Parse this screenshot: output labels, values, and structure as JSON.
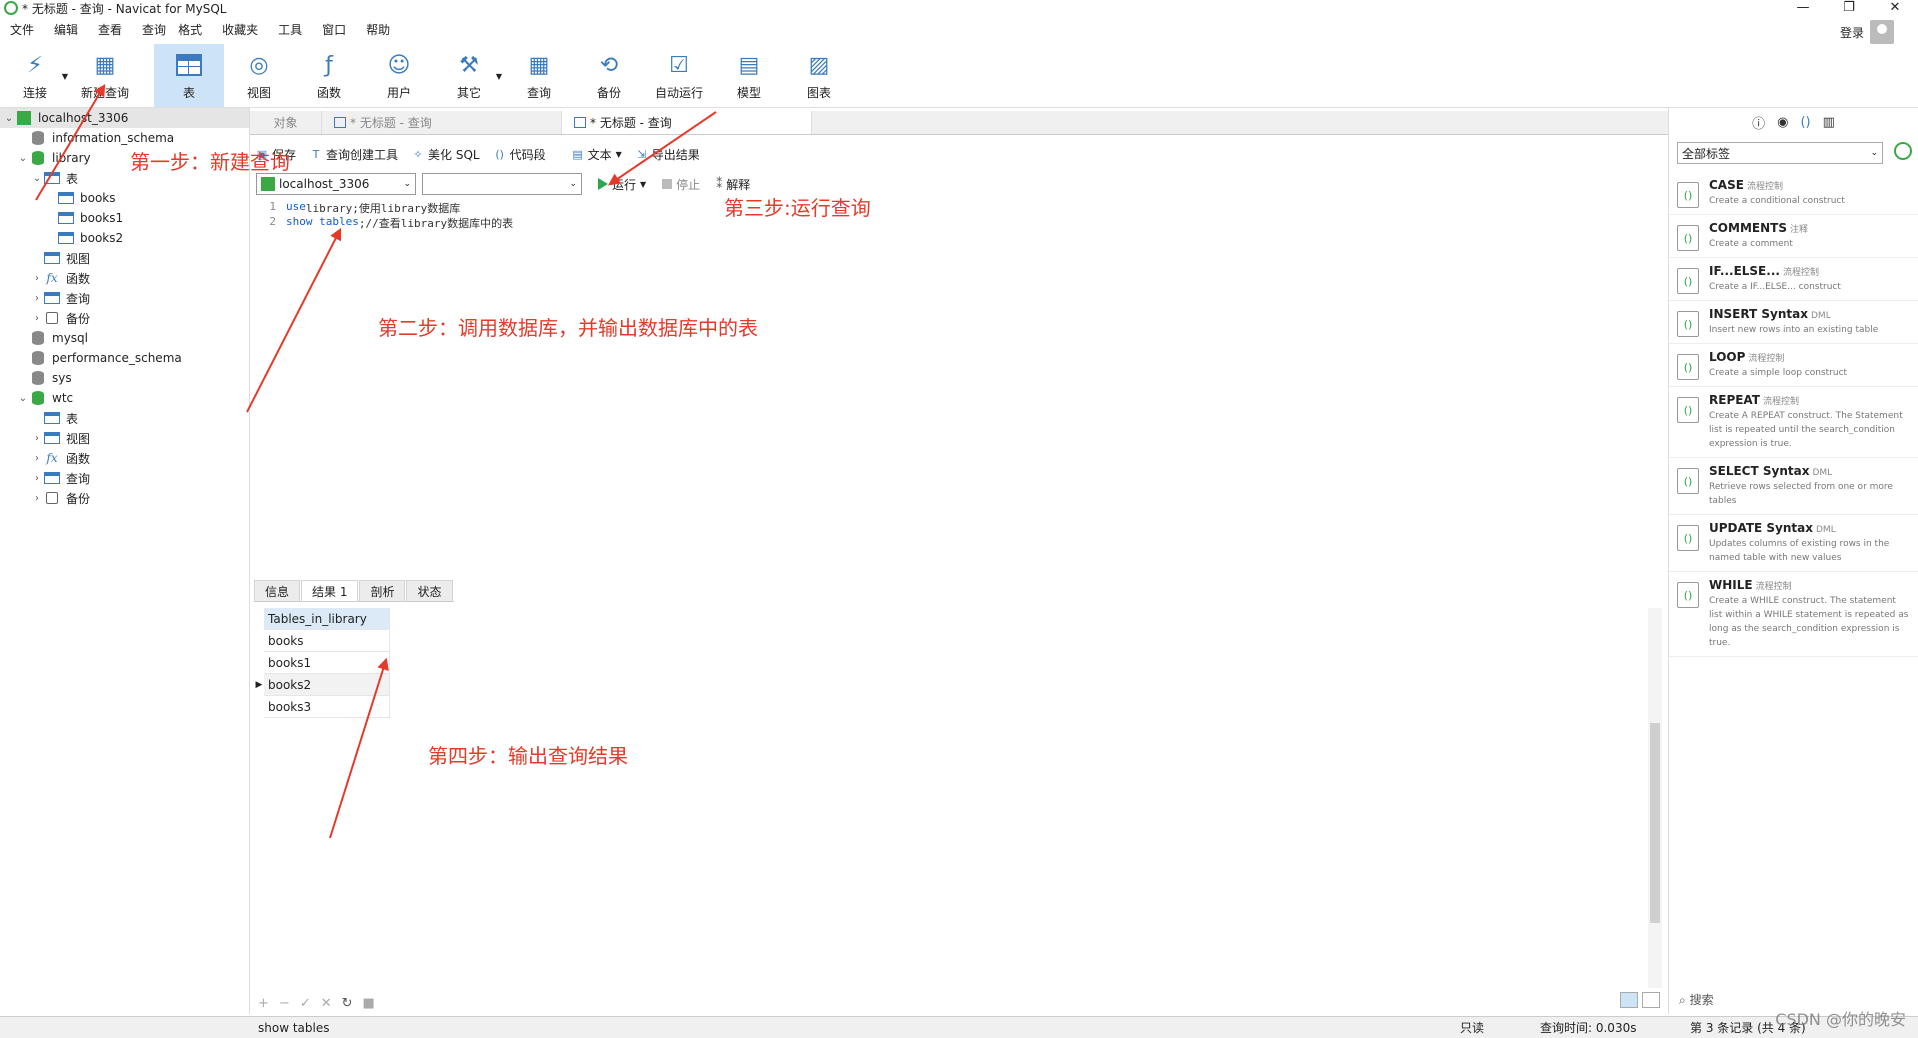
{
  "window": {
    "title": "* 无标题 - 查询 - Navicat for MySQL",
    "controls": [
      "—",
      "❐",
      "✕"
    ]
  },
  "menu": [
    "文件",
    "编辑",
    "查看",
    "查询",
    "格式",
    "收藏夹",
    "工具",
    "窗口",
    "帮助"
  ],
  "login_label": "登录",
  "toolbar": [
    {
      "label": "连接",
      "icon": "plug-icon",
      "drop": true
    },
    {
      "label": "新建查询",
      "icon": "new-query-icon"
    },
    {
      "label": "表",
      "icon": "table-icon",
      "active": true
    },
    {
      "label": "视图",
      "icon": "view-icon"
    },
    {
      "label": "函数",
      "icon": "function-icon"
    },
    {
      "label": "用户",
      "icon": "user-icon"
    },
    {
      "label": "其它",
      "icon": "tools-icon",
      "drop": true
    },
    {
      "label": "查询",
      "icon": "query-icon"
    },
    {
      "label": "备份",
      "icon": "backup-icon"
    },
    {
      "label": "自动运行",
      "icon": "automation-icon"
    },
    {
      "label": "模型",
      "icon": "model-icon"
    },
    {
      "label": "图表",
      "icon": "chart-icon"
    }
  ],
  "tree": [
    {
      "label": "localhost_3306",
      "level": 0,
      "chev": "⌄",
      "icon": "conn",
      "selected": true
    },
    {
      "label": "information_schema",
      "level": 1,
      "chev": "",
      "icon": "db"
    },
    {
      "label": "library",
      "level": 1,
      "chev": "⌄",
      "icon": "dbgreen"
    },
    {
      "label": "表",
      "level": 2,
      "chev": "⌄",
      "icon": "table"
    },
    {
      "label": "books",
      "level": 3,
      "chev": "",
      "icon": "table"
    },
    {
      "label": "books1",
      "level": 3,
      "chev": "",
      "icon": "table"
    },
    {
      "label": "books2",
      "level": 3,
      "chev": "",
      "icon": "table"
    },
    {
      "label": "视图",
      "level": 2,
      "chev": "",
      "icon": "table"
    },
    {
      "label": "函数",
      "level": 2,
      "chev": "›",
      "icon": "fx"
    },
    {
      "label": "查询",
      "level": 2,
      "chev": "›",
      "icon": "table"
    },
    {
      "label": "备份",
      "level": 2,
      "chev": "›",
      "icon": "backup"
    },
    {
      "label": "mysql",
      "level": 1,
      "chev": "",
      "icon": "db"
    },
    {
      "label": "performance_schema",
      "level": 1,
      "chev": "",
      "icon": "db"
    },
    {
      "label": "sys",
      "level": 1,
      "chev": "",
      "icon": "db"
    },
    {
      "label": "wtc",
      "level": 1,
      "chev": "⌄",
      "icon": "dbgreen"
    },
    {
      "label": "表",
      "level": 2,
      "chev": "",
      "icon": "table"
    },
    {
      "label": "视图",
      "level": 2,
      "chev": "›",
      "icon": "table"
    },
    {
      "label": "函数",
      "level": 2,
      "chev": "›",
      "icon": "fx"
    },
    {
      "label": "查询",
      "level": 2,
      "chev": "›",
      "icon": "table"
    },
    {
      "label": "备份",
      "level": 2,
      "chev": "›",
      "icon": "backup"
    }
  ],
  "doc_tabs": [
    {
      "label": "对象",
      "active": false
    },
    {
      "label": "* 无标题 - 查询",
      "active": false
    },
    {
      "label": "* 无标题 - 查询",
      "active": true
    }
  ],
  "query_toolbar": {
    "save": "保存",
    "builder": "查询创建工具",
    "beautify": "美化 SQL",
    "snippet": "代码段",
    "text": "文本",
    "export": "导出结果"
  },
  "query_bar": {
    "connection": "localhost_3306",
    "database": "",
    "run": "运行",
    "stop": "停止",
    "explain": "解释"
  },
  "editor_lines": [
    {
      "num": "1",
      "kw": "use",
      "rest": " library;使用library数据库"
    },
    {
      "num": "2",
      "kw": "show tables",
      "rest": ";//查看library数据库中的表"
    }
  ],
  "result_tabs": [
    {
      "label": "信息",
      "active": false
    },
    {
      "label": "结果 1",
      "active": true
    },
    {
      "label": "剖析",
      "active": false
    },
    {
      "label": "状态",
      "active": false
    }
  ],
  "result": {
    "column": "Tables_in_library",
    "rows": [
      "books",
      "books1",
      "books2",
      "books3"
    ],
    "current_row": 2
  },
  "grid_tools": [
    "+",
    "−",
    "✓",
    "✕",
    "↻",
    "■"
  ],
  "status": {
    "sql": "show tables",
    "readonly": "只读",
    "query_time": "查询时间: 0.030s",
    "records": "第 3 条记录 (共 4 条)"
  },
  "watermark": "CSDN @你的晚安",
  "right_pane": {
    "filter": "全部标签",
    "search": "搜索",
    "snippets": [
      {
        "title": "CASE",
        "tag": "流程控制",
        "desc": "Create a conditional construct"
      },
      {
        "title": "COMMENTS",
        "tag": "注释",
        "desc": "Create a comment"
      },
      {
        "title": "IF...ELSE...",
        "tag": "流程控制",
        "desc": "Create a IF...ELSE... construct"
      },
      {
        "title": "INSERT Syntax",
        "tag": "DML",
        "desc": "Insert new rows into an existing table"
      },
      {
        "title": "LOOP",
        "tag": "流程控制",
        "desc": "Create a simple loop construct"
      },
      {
        "title": "REPEAT",
        "tag": "流程控制",
        "desc": "Create A REPEAT construct. The Statement list is repeated until the search_condition expression is true."
      },
      {
        "title": "SELECT Syntax",
        "tag": "DML",
        "desc": "Retrieve rows selected from one or more tables"
      },
      {
        "title": "UPDATE Syntax",
        "tag": "DML",
        "desc": "Updates columns of existing rows in the named table with new values"
      },
      {
        "title": "WHILE",
        "tag": "流程控制",
        "desc": "Create a WHILE construct. The statement list within a WHILE statement is repeated as long as the search_condition expression is true."
      }
    ]
  },
  "annotations": {
    "step1": "第一步：新建查询",
    "step2": "第二步：调用数据库，并输出数据库中的表",
    "step3": "第三步:运行查询",
    "step4": "第四步：输出查询结果"
  },
  "colors": {
    "accent": "#3a7bbf",
    "annotation": "#e53a2a",
    "run_green": "#2ea84a",
    "active_toolbar": "#cde3f7"
  }
}
